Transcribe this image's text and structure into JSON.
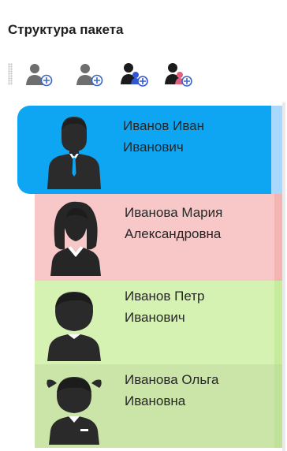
{
  "panel": {
    "title": "Структура пакета"
  },
  "toolbar": {
    "buttons": [
      {
        "name": "add-adult-male-button",
        "icon": "person-add-icon",
        "color": "#6e6e6e",
        "accent": "#3b67c7"
      },
      {
        "name": "add-adult-female-button",
        "icon": "person-add-icon",
        "color": "#6e6e6e",
        "accent": "#3b67c7"
      },
      {
        "name": "add-child-male-button",
        "icon": "child-add-icon",
        "color": "#1b1b1b",
        "accent": "#2f57d6"
      },
      {
        "name": "add-child-female-button",
        "icon": "child-add-icon",
        "color": "#1b1b1b",
        "accent": "#e0607e"
      }
    ]
  },
  "members": [
    {
      "name": "Иванов Иван\nИванович",
      "avatar": "man-icon",
      "color": "#0ea6f3",
      "selected": true
    },
    {
      "name": "Иванова Мария\nАлександровна",
      "avatar": "woman-icon",
      "color": "#f8c8c8",
      "selected": false
    },
    {
      "name": "Иванов Петр\nИванович",
      "avatar": "boy-icon",
      "color": "#d5f2b3",
      "selected": false
    },
    {
      "name": "Иванова Ольга\nИвановна",
      "avatar": "girl-icon",
      "color": "#cbe5a8",
      "selected": false
    }
  ]
}
